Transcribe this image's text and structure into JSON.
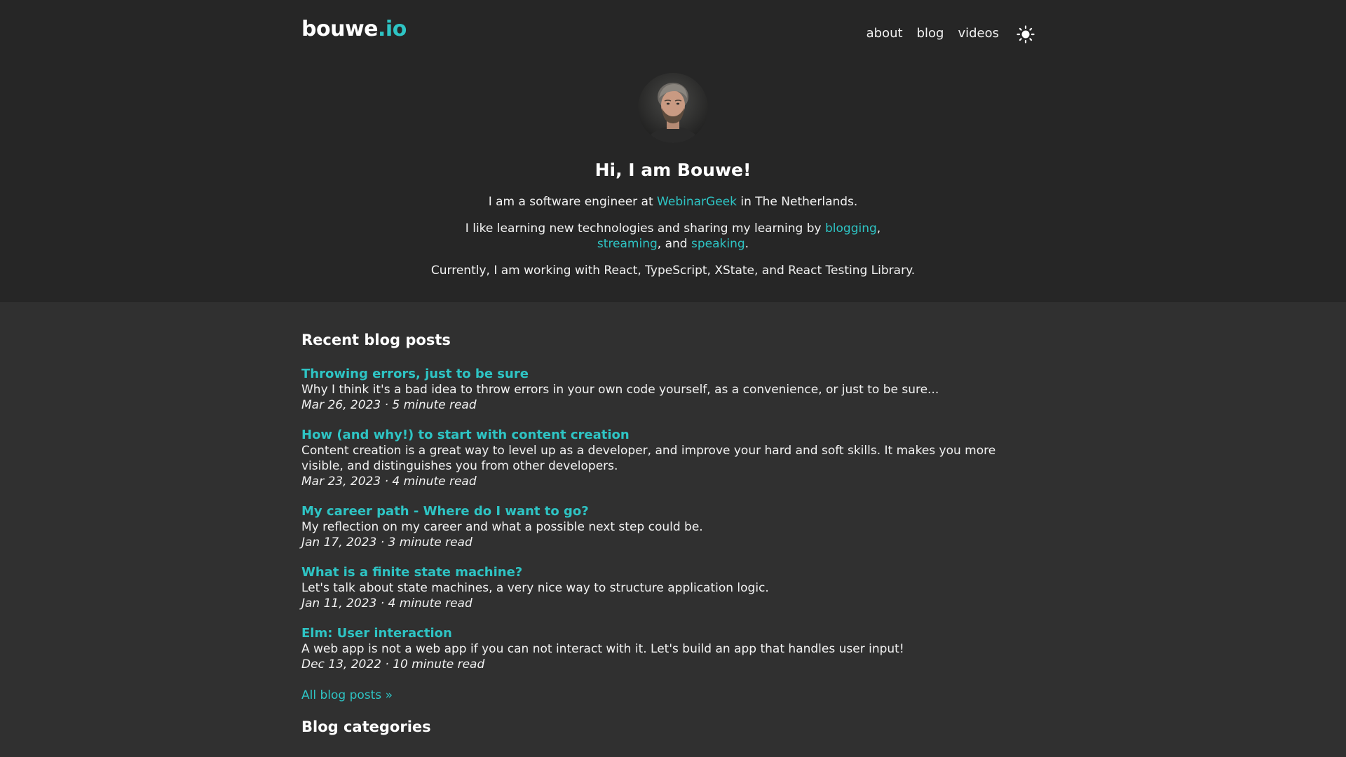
{
  "header": {
    "logo_main": "bouwe",
    "logo_tld": ".io",
    "nav": [
      "about",
      "blog",
      "videos"
    ],
    "theme_toggle_icon": "sun-icon"
  },
  "hero": {
    "avatar_icon": "avatar-photo",
    "greeting": "Hi, I am Bouwe!",
    "intro_pre": "I am a software engineer at ",
    "intro_link": "WebinarGeek",
    "intro_post": " in The Netherlands.",
    "learning_pre": "I like learning new technologies and sharing my learning by ",
    "learning_link1": "blogging",
    "learning_sep1": ", ",
    "learning_link2": "streaming",
    "learning_sep2": ", and ",
    "learning_link3": "speaking",
    "learning_end": ".",
    "current": "Currently, I am working with React, TypeScript, XState, and React Testing Library."
  },
  "recent": {
    "title": "Recent blog posts",
    "posts": [
      {
        "title": "Throwing errors, just to be sure",
        "desc": "Why I think it's a bad idea to throw errors in your own code yourself, as a convenience, or just to be sure...",
        "meta": "Mar 26, 2023 · 5 minute read"
      },
      {
        "title": "How (and why!) to start with content creation",
        "desc": "Content creation is a great way to level up as a developer, and improve your hard and soft skills. It makes you more visible, and distinguishes you from other developers.",
        "meta": "Mar 23, 2023 · 4 minute read"
      },
      {
        "title": "My career path - Where do I want to go?",
        "desc": "My reflection on my career and what a possible next step could be.",
        "meta": "Jan 17, 2023 · 3 minute read"
      },
      {
        "title": "What is a finite state machine?",
        "desc": "Let's talk about state machines, a very nice way to structure application logic.",
        "meta": "Jan 11, 2023 · 4 minute read"
      },
      {
        "title": "Elm: User interaction",
        "desc": "A web app is not a web app if you can not interact with it. Let's build an app that handles user input!",
        "meta": "Dec 13, 2022 · 10 minute read"
      }
    ],
    "all_link": "All blog posts »"
  },
  "categories": {
    "title": "Blog categories"
  },
  "colors": {
    "accent": "#2ec4c4",
    "header_bg": "#262626",
    "page_bg": "#303030"
  }
}
